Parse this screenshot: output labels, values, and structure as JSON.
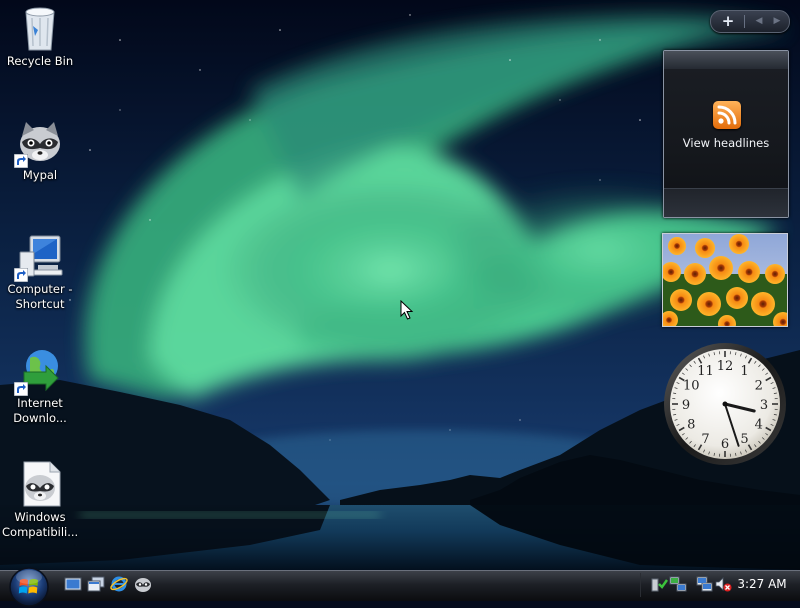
{
  "desktop": {
    "icons": [
      {
        "label": "Recycle Bin"
      },
      {
        "label": "Mypal"
      },
      {
        "label": "Computer - Shortcut"
      },
      {
        "label": "Internet Downlo..."
      },
      {
        "label": "Windows Compatibili..."
      }
    ]
  },
  "sidebar": {
    "add_label": "+",
    "prev_label": "◀",
    "next_label": "▶",
    "feed": {
      "label": "View headlines"
    }
  },
  "clock_gadget": {
    "time": "3:27",
    "numbers": [
      "12",
      "1",
      "2",
      "3",
      "4",
      "5",
      "6",
      "7",
      "8",
      "9",
      "10",
      "11"
    ]
  },
  "taskbar": {
    "quick_launch": [
      "show-desktop-icon",
      "switch-windows-icon",
      "internet-explorer-icon",
      "mypal-icon"
    ],
    "tray_icons": [
      "security-icon",
      "network-icon",
      "volume-muted-icon"
    ],
    "clock": "3:27 AM"
  },
  "colors": {
    "aurora": "#4fd89a",
    "sky": "#0a1e3f",
    "taskbar": "#1d2026",
    "feed_orange": "#f08a1c"
  }
}
